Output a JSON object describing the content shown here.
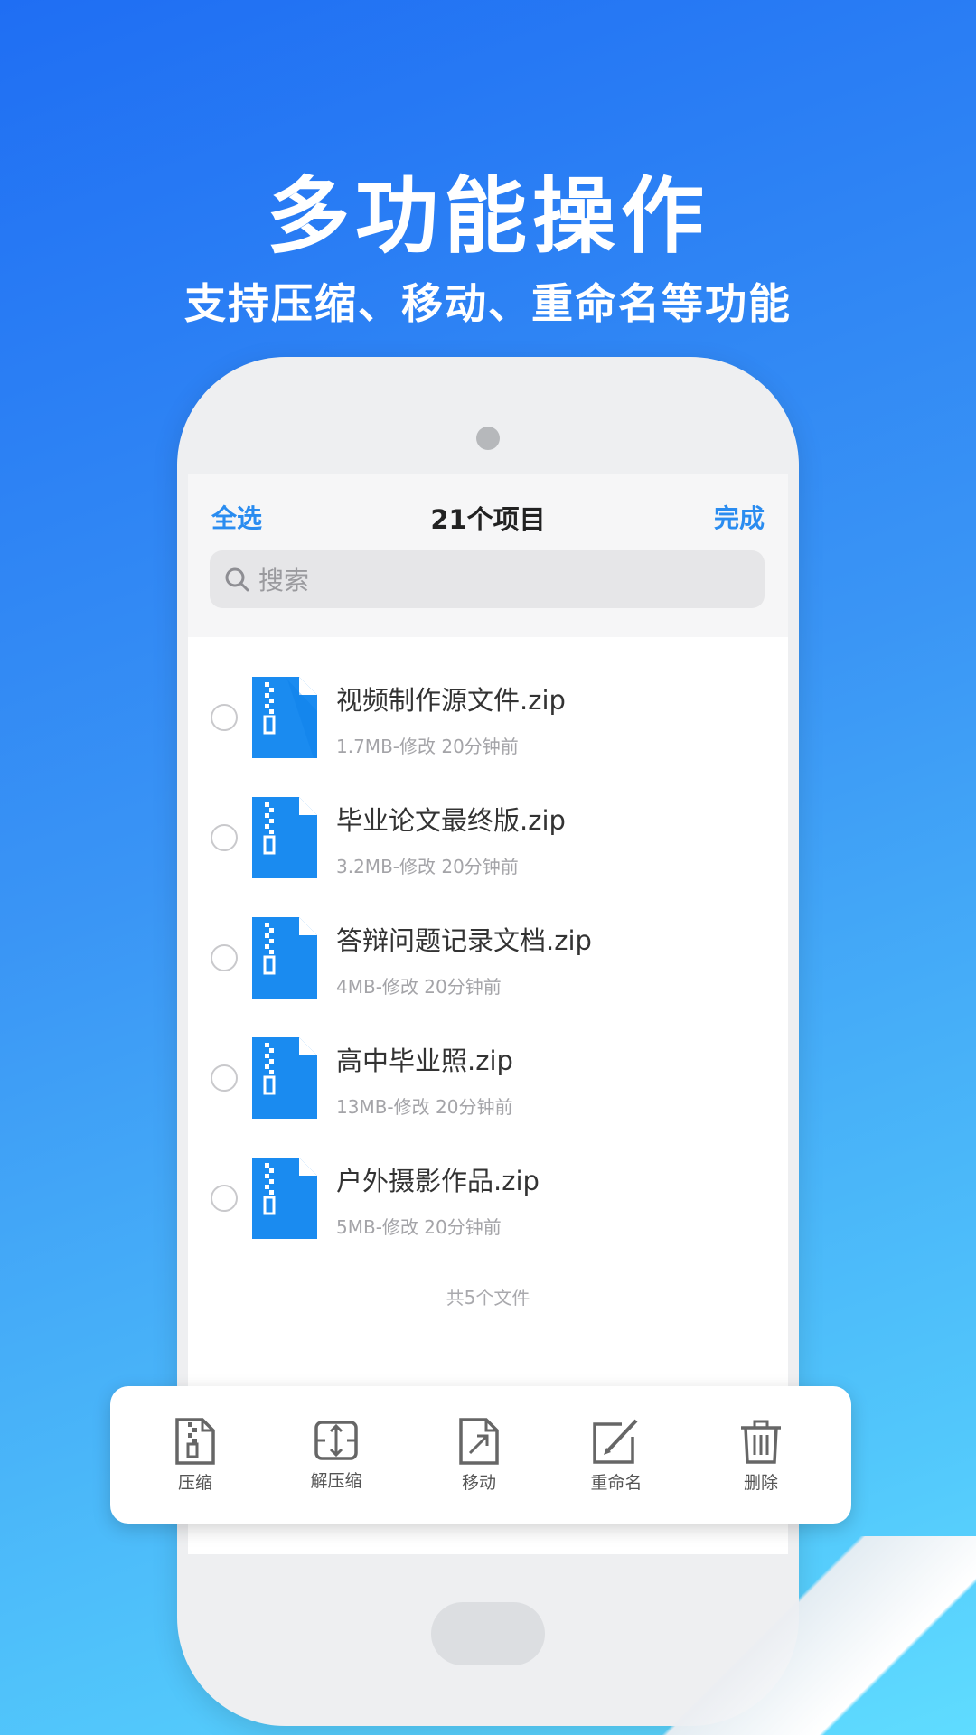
{
  "headline": "多功能操作",
  "subline": "支持压缩、移动、重命名等功能",
  "screen": {
    "nav": {
      "left": "全选",
      "title": "21个项目",
      "right": "完成"
    },
    "search": {
      "placeholder": "搜索",
      "icon": "search-icon"
    },
    "files": [
      {
        "name": "视频制作源文件.zip",
        "info": "1.7MB-修改 20分钟前"
      },
      {
        "name": "毕业论文最终版.zip",
        "info": "3.2MB-修改 20分钟前"
      },
      {
        "name": "答辩问题记录文档.zip",
        "info": "4MB-修改 20分钟前"
      },
      {
        "name": "高中毕业照.zip",
        "info": "13MB-修改 20分钟前"
      },
      {
        "name": "户外摄影作品.zip",
        "info": "5MB-修改 20分钟前"
      }
    ],
    "footer": "共5个文件"
  },
  "toolbar": {
    "items": [
      {
        "label": "压缩",
        "icon": "compress-icon"
      },
      {
        "label": "解压缩",
        "icon": "decompress-icon"
      },
      {
        "label": "移动",
        "icon": "move-icon"
      },
      {
        "label": "重命名",
        "icon": "rename-icon"
      },
      {
        "label": "删除",
        "icon": "trash-icon"
      }
    ]
  },
  "colors": {
    "accent": "#2a8cf0",
    "file_icon": "#1a8bf0",
    "bg_top": "#1f6ef3",
    "bg_bottom": "#5fdcff"
  }
}
